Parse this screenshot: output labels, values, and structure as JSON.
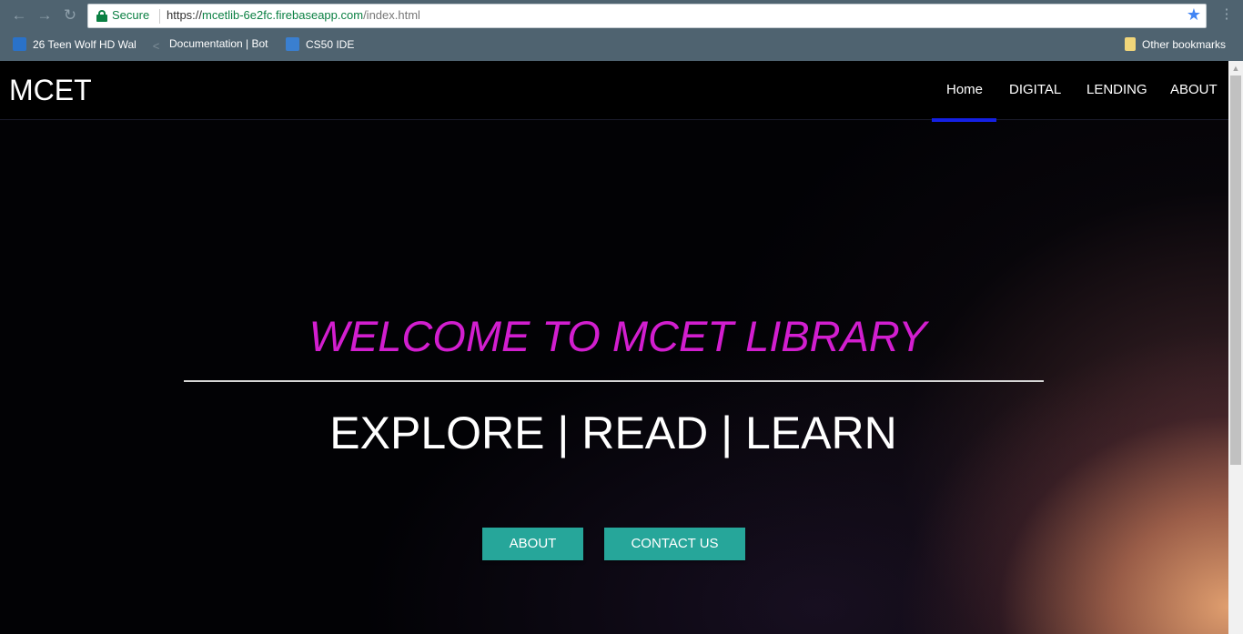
{
  "browser": {
    "security_label": "Secure",
    "url_scheme": "https://",
    "url_host": "mcetlib-6e2fc.firebaseapp.com",
    "url_path": "/index.html",
    "bookmarks": [
      {
        "label": "26 Teen Wolf HD Wal",
        "icon": "teen-wolf-favicon"
      },
      {
        "label": "Documentation | Bot",
        "icon": "share-icon"
      },
      {
        "label": "CS50 IDE",
        "icon": "cs50-favicon"
      }
    ],
    "other_bookmarks_label": "Other bookmarks"
  },
  "nav": {
    "brand": "MCET",
    "links": [
      "Home",
      "DIGITAL",
      "LENDING",
      "ABOUT"
    ],
    "active_link": "Home",
    "active_color": "#1420e4"
  },
  "hero": {
    "welcome": "WELCOME TO MCET LIBRARY",
    "welcome_color": "#d21ecf",
    "tagline": "EXPLORE | READ | LEARN",
    "buttons": [
      "ABOUT",
      "CONTACT US"
    ],
    "button_color": "#26a69a"
  }
}
